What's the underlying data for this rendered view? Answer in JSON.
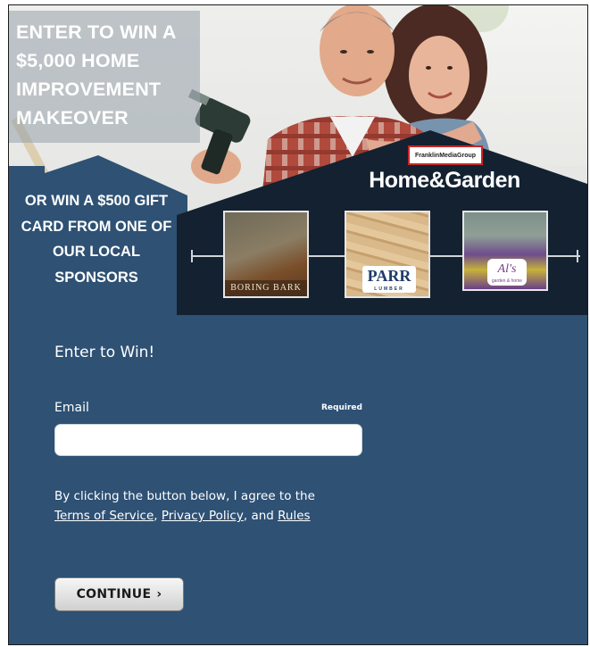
{
  "hero": {
    "headline": "ENTER TO WIN A $5,000 HOME IMPROVEMENT MAKEOVER",
    "subhead": "OR WIN A $500 GIFT CARD FROM ONE OF OUR LOCAL SPONSORS",
    "brand_logo": "FranklinMediaGroup",
    "brand_title": "Home&Garden",
    "sponsors": [
      {
        "name": "BORING BARK"
      },
      {
        "name": "PARR",
        "sub": "LUMBER"
      },
      {
        "name": "Al's",
        "sub": "garden & home"
      }
    ]
  },
  "form": {
    "title": "Enter to Win!",
    "email_label": "Email",
    "required_label": "Required",
    "email_value": "",
    "agree_prefix": "By clicking the button below, I agree to the ",
    "terms_link": "Terms of Service",
    "sep": ", ",
    "privacy_link": "Privacy Policy",
    "and_text": ", and ",
    "rules_link": "Rules",
    "continue_label": "CONTINUE",
    "continue_chevron": "›"
  },
  "colors": {
    "panel": "#2e5174",
    "house": "#132131",
    "brand_red": "#c62828"
  }
}
